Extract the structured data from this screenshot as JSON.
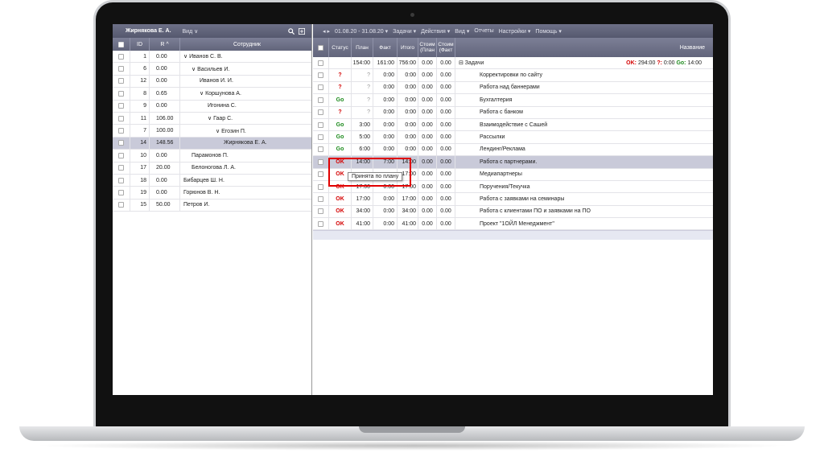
{
  "left_panel": {
    "user": "Жирнякова Е. А.",
    "view_menu": "Вид ∨",
    "columns": {
      "id": "ID",
      "r": "R ^",
      "employee": "Сотрудник"
    },
    "rows": [
      {
        "id": "1",
        "r": "0.00",
        "name": "∨ Иванов С. В.",
        "indent": 0
      },
      {
        "id": "6",
        "r": "0.00",
        "name": "∨ Васильев И.",
        "indent": 1
      },
      {
        "id": "12",
        "r": "0.00",
        "name": "Иванов И. И.",
        "indent": 2
      },
      {
        "id": "8",
        "r": "0.65",
        "name": "∨ Коршунова А.",
        "indent": 2
      },
      {
        "id": "9",
        "r": "0.00",
        "name": "Игонина С.",
        "indent": 3
      },
      {
        "id": "11",
        "r": "106.00",
        "name": "∨ Гаар С.",
        "indent": 3
      },
      {
        "id": "7",
        "r": "100.00",
        "name": "∨ Егозин П.",
        "indent": 4
      },
      {
        "id": "14",
        "r": "148.56",
        "name": "Жирнякова Е. А.",
        "indent": 5,
        "selected": true
      },
      {
        "id": "10",
        "r": "0.00",
        "name": "Парамонов П.",
        "indent": 1
      },
      {
        "id": "17",
        "r": "20.00",
        "name": "Белоногова Л. А.",
        "indent": 1
      },
      {
        "id": "18",
        "r": "0.00",
        "name": "Бибарцев Ш. Н.",
        "indent": 0
      },
      {
        "id": "19",
        "r": "0.00",
        "name": "Горюнов В. Н.",
        "indent": 0
      },
      {
        "id": "15",
        "r": "50.00",
        "name": "Петров И.",
        "indent": 0
      }
    ]
  },
  "right_panel": {
    "toolbar": {
      "nav": "◂ ▸",
      "period": "01.08.20 - 31.08.20 ▾",
      "menus": [
        "Задачи ▾",
        "Действия ▾",
        "Вид ▾",
        "Отчеты",
        "Настройки ▾",
        "Помощь ▾"
      ]
    },
    "columns": {
      "status": "Статус",
      "plan": "План",
      "fact": "Факт",
      "total": "Итого",
      "cost_plan": "Стоим (План",
      "cost_fact": "Стоим (Факт",
      "name": "Название"
    },
    "summary": {
      "plan": "154:00",
      "fact": "161:00",
      "total": "756:00",
      "cost_plan": "0.00",
      "cost_fact": "0.00",
      "name": "⊟ Задачи",
      "ok_label": "OK:",
      "ok_value": "294:00",
      "q_label": "?:",
      "q_value": "0:00",
      "go_label": "Go:",
      "go_value": "14:00"
    },
    "rows": [
      {
        "status": "?",
        "kind": "q",
        "plan": "?",
        "fact": "0:00",
        "total": "0:00",
        "cp": "0.00",
        "cf": "0.00",
        "name": "Корректировки по сайту"
      },
      {
        "status": "?",
        "kind": "q",
        "plan": "?",
        "fact": "0:00",
        "total": "0:00",
        "cp": "0.00",
        "cf": "0.00",
        "name": "Работа над баннерами"
      },
      {
        "status": "Go",
        "kind": "go",
        "plan": "?",
        "fact": "0:00",
        "total": "0:00",
        "cp": "0.00",
        "cf": "0.00",
        "name": "Бухгалтерия"
      },
      {
        "status": "?",
        "kind": "q",
        "plan": "?",
        "fact": "0:00",
        "total": "0:00",
        "cp": "0.00",
        "cf": "0.00",
        "name": "Работа с банком"
      },
      {
        "status": "Go",
        "kind": "go",
        "plan": "3:00",
        "fact": "0:00",
        "total": "0:00",
        "cp": "0.00",
        "cf": "0.00",
        "name": "Взаимодействие с Сашей"
      },
      {
        "status": "Go",
        "kind": "go",
        "plan": "5:00",
        "fact": "0:00",
        "total": "0:00",
        "cp": "0.00",
        "cf": "0.00",
        "name": "Рассылки"
      },
      {
        "status": "Go",
        "kind": "go",
        "plan": "6:00",
        "fact": "0:00",
        "total": "0:00",
        "cp": "0.00",
        "cf": "0.00",
        "name": "Лендинг/Реклама"
      },
      {
        "status": "OK",
        "kind": "ok",
        "plan": "14:00",
        "fact": "7:00",
        "total": "14:00",
        "cp": "0.00",
        "cf": "0.00",
        "name": "Работа с партнерами.",
        "selected": true
      },
      {
        "status": "OK",
        "kind": "ok",
        "plan": "",
        "fact": "",
        "total": "17:00",
        "cp": "0.00",
        "cf": "0.00",
        "name": "Медиапартнеры"
      },
      {
        "status": "OK",
        "kind": "ok",
        "plan": "17:00",
        "fact": "0:00",
        "total": "17:00",
        "cp": "0.00",
        "cf": "0.00",
        "name": "Поручения/Текучка"
      },
      {
        "status": "OK",
        "kind": "ok",
        "plan": "17:00",
        "fact": "0:00",
        "total": "17:00",
        "cp": "0.00",
        "cf": "0.00",
        "name": "Работа с заявками на семинары"
      },
      {
        "status": "OK",
        "kind": "ok",
        "plan": "34:00",
        "fact": "0:00",
        "total": "34:00",
        "cp": "0.00",
        "cf": "0.00",
        "name": "Работа с клиентами ПО и заявками на ПО"
      },
      {
        "status": "OK",
        "kind": "ok",
        "plan": "41:00",
        "fact": "0:00",
        "total": "41:00",
        "cp": "0.00",
        "cf": "0.00",
        "name": "Проект \"1ОЙЛ Менеджмент\""
      }
    ],
    "tooltip": "Принята по плану"
  }
}
